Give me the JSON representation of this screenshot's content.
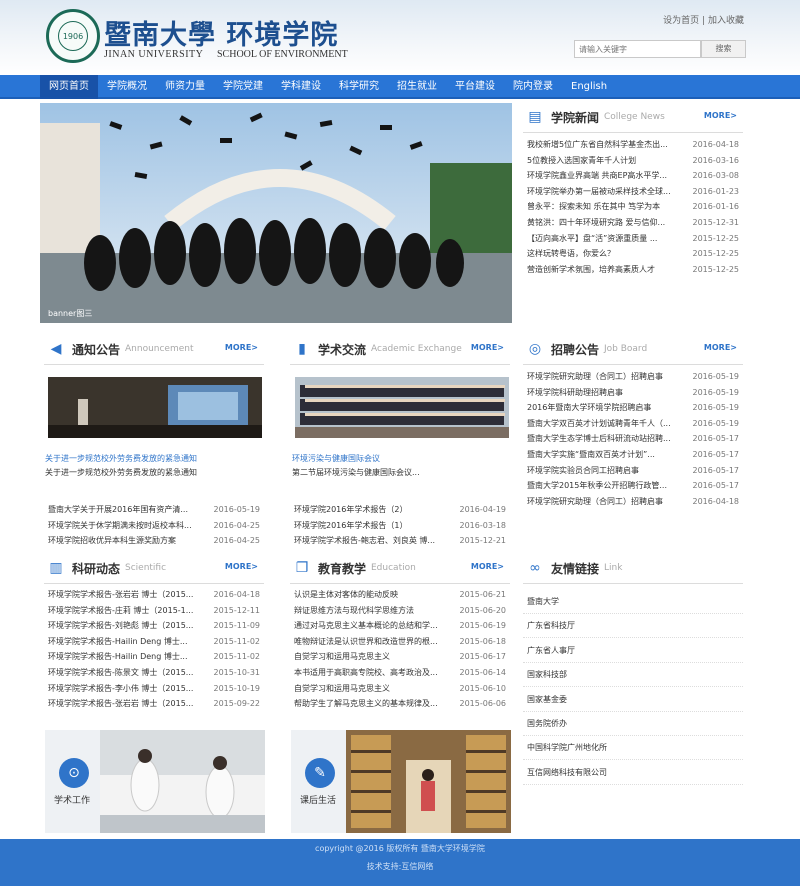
{
  "header": {
    "logo_text": "1906",
    "school_cn": "暨南大學 环境学院",
    "school_en_university": "JINAN UNIVERSITY",
    "school_en_school": "SCHOOL OF ENVIRONMENT",
    "toplinks": {
      "home": "设为首页",
      "sep": "|",
      "fav": "加入收藏"
    },
    "search": {
      "placeholder": "请输入关键字",
      "button": "搜索"
    }
  },
  "nav": [
    "网页首页",
    "学院概况",
    "师资力量",
    "学院党建",
    "学科建设",
    "科学研究",
    "招生就业",
    "平台建设",
    "院内登录",
    "English"
  ],
  "banner": {
    "caption": "banner图三"
  },
  "college_news": {
    "title": "学院新闻",
    "sub": "College News",
    "more": "MORE>",
    "items": [
      {
        "t": "我校新增5位广东省自然科学基金杰出...",
        "d": "2016-04-18"
      },
      {
        "t": "5位教授入选国家青年千人计划",
        "d": "2016-03-16"
      },
      {
        "t": "环境学院鑫业界高端 共商EP高水平学...",
        "d": "2016-03-08"
      },
      {
        "t": "环境学院举办第一届被动采样技术全球...",
        "d": "2016-01-23"
      },
      {
        "t": "曾永平：探索未知 乐在其中 笃学为本",
        "d": "2016-01-16"
      },
      {
        "t": "黄铭洪：四十年环境研究路 爱与信仰...",
        "d": "2015-12-31"
      },
      {
        "t": "【迈向高水平】盘“活”资源重质量 ...",
        "d": "2015-12-25"
      },
      {
        "t": "这样玩转粤语，你爱么？",
        "d": "2015-12-25"
      },
      {
        "t": "营造创新学术氛围，培养高素质人才",
        "d": "2015-12-25"
      }
    ]
  },
  "notice": {
    "title": "通知公告",
    "sub": "Announcement",
    "more": "MORE>",
    "cap_blue": "关于进一步规范校外劳务费发放的紧急通知",
    "cap_black": "关于进一步规范校外劳务费发放的紧急通知",
    "items": [
      {
        "t": "暨南大学关于开展2016年国有资产清...",
        "d": "2016-05-19"
      },
      {
        "t": "环境学院关于休学期满未按时返校本科...",
        "d": "2016-04-25"
      },
      {
        "t": "环境学院招收优异本科生源奖励方案",
        "d": "2016-04-25"
      }
    ]
  },
  "academic": {
    "title": "学术交流",
    "sub": "Academic Exchange",
    "more": "MORE>",
    "cap_blue": "环境污染与健康国际会议",
    "cap_black": "第二节届环境污染与健康国际会议...",
    "items": [
      {
        "t": "环境学院2016年学术报告（2）",
        "d": "2016-04-19"
      },
      {
        "t": "环境学院2016年学术报告（1）",
        "d": "2016-03-18"
      },
      {
        "t": "环境学院学术报告-鲍志君、刘良英 博...",
        "d": "2015-12-21"
      }
    ]
  },
  "jobs": {
    "title": "招聘公告",
    "sub": "Job Board",
    "more": "MORE>",
    "items": [
      {
        "t": "环境学院研究助理（合同工）招聘启事",
        "d": "2016-05-19"
      },
      {
        "t": "环境学院科研助理招聘启事",
        "d": "2016-05-19"
      },
      {
        "t": "2016年暨南大学环境学院招聘启事",
        "d": "2016-05-19"
      },
      {
        "t": "暨南大学双百英才计划诚聘青年千人（...",
        "d": "2016-05-19"
      },
      {
        "t": "暨南大学生态学博士后科研流动站招聘...",
        "d": "2016-05-17"
      },
      {
        "t": "暨南大学实施“暨南双百英才计划”...",
        "d": "2016-05-17"
      },
      {
        "t": "环境学院实验员合同工招聘启事",
        "d": "2016-05-17"
      },
      {
        "t": "暨南大学2015年秋季公开招聘行政管...",
        "d": "2016-05-17"
      },
      {
        "t": "环境学院研究助理（合同工）招聘启事",
        "d": "2016-04-18"
      }
    ]
  },
  "research": {
    "title": "科研动态",
    "sub": "Scientific",
    "more": "MORE>",
    "items": [
      {
        "t": "环境学院学术报告-张岩岩 博士（2015...",
        "d": "2016-04-18"
      },
      {
        "t": "环境学院学术报告-庄莉 博士（2015-1...",
        "d": "2015-12-11"
      },
      {
        "t": "环境学院学术报告-刘艳彪 博士（2015...",
        "d": "2015-11-09"
      },
      {
        "t": "环境学院学术报告-Hailin Deng 博士...",
        "d": "2015-11-02"
      },
      {
        "t": "环境学院学术报告-Hailin Deng 博士...",
        "d": "2015-11-02"
      },
      {
        "t": "环境学院学术报告-陈景文 博士（2015...",
        "d": "2015-10-31"
      },
      {
        "t": "环境学院学术报告-李小伟 博士（2015...",
        "d": "2015-10-19"
      },
      {
        "t": "环境学院学术报告-张岩岩 博士（2015...",
        "d": "2015-09-22"
      }
    ]
  },
  "education": {
    "title": "教育教学",
    "sub": "Education",
    "more": "MORE>",
    "items": [
      {
        "t": "认识是主体对客体的能动反映",
        "d": "2015-06-21"
      },
      {
        "t": "辩证思维方法与现代科学思维方法",
        "d": "2015-06-20"
      },
      {
        "t": "通过对马克思主义基本概论的总结和学...",
        "d": "2015-06-19"
      },
      {
        "t": "唯物辩证法是认识世界和改造世界的根...",
        "d": "2015-06-18"
      },
      {
        "t": "自觉学习和运用马克思主义",
        "d": "2015-06-17"
      },
      {
        "t": "本书适用于高职高专院校、高考政治及...",
        "d": "2015-06-14"
      },
      {
        "t": "自觉学习和运用马克思主义",
        "d": "2015-06-10"
      },
      {
        "t": "帮助学生了解马克思主义的基本规律及...",
        "d": "2015-06-06"
      }
    ]
  },
  "friend_links": {
    "title": "友情链接",
    "sub": "Link",
    "items": [
      "暨南大学",
      "广东省科技厅",
      "广东省人事厅",
      "国家科技部",
      "国家基金委",
      "国务院侨办",
      "中国科学院广州地化所",
      "互信网络科技有限公司"
    ]
  },
  "promo": {
    "left": "学术工作",
    "right": "课后生活"
  },
  "footer": {
    "copyright": "copyright @2016 版权所有 暨南大学环境学院",
    "support": "技术支持:互信网络"
  },
  "colors": {
    "nav": "#2975d6",
    "accent": "#2f74c9",
    "footer": "#2f74c9"
  }
}
